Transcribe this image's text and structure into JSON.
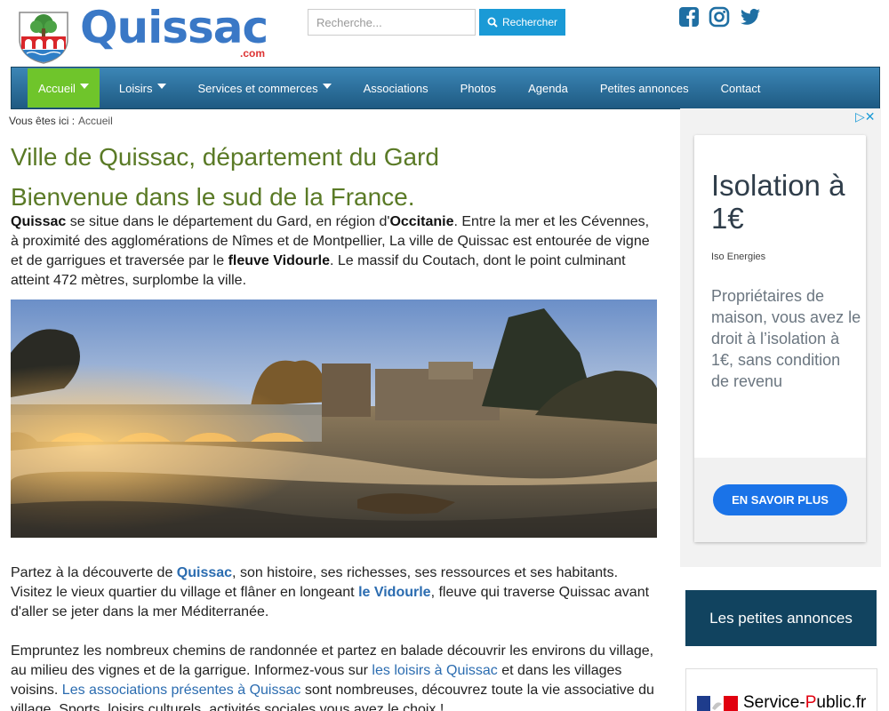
{
  "header": {
    "logo_name": "Quissac",
    "logo_suffix": ".com",
    "search_placeholder": "Recherche...",
    "search_button": "Rechercher",
    "social": [
      "facebook-icon",
      "instagram-icon",
      "twitter-icon"
    ]
  },
  "nav": {
    "items": [
      {
        "label": "Accueil",
        "dropdown": true,
        "active": true
      },
      {
        "label": "Loisirs",
        "dropdown": true
      },
      {
        "label": "Services et commerces",
        "dropdown": true
      },
      {
        "label": "Associations"
      },
      {
        "label": "Photos"
      },
      {
        "label": "Agenda"
      },
      {
        "label": "Petites annonces"
      },
      {
        "label": "Contact"
      }
    ]
  },
  "breadcrumb": {
    "label": "Vous êtes ici :",
    "current": "Accueil"
  },
  "main": {
    "title": "Ville de Quissac, département du Gard",
    "subtitle": "Bienvenue dans le sud de la France.",
    "intro": {
      "b1": "Quissac",
      "t1": " se situe dans le département du Gard, en région d'",
      "b2": "Occitanie",
      "t2": ". Entre la mer et les Cévennes, à proximité des agglomérations de Nîmes et de Montpellier, La ville de Quissac est entourée de vigne et de garrigues et traversée par le ",
      "b3": "fleuve Vidourle",
      "t3": ". Le massif du Coutach, dont le point culminant atteint 472 mètres, surplombe la ville."
    },
    "p2": {
      "t1": "Partez à la découverte de ",
      "l1": "Quissac",
      "t2": ", son histoire, ses richesses, ses ressources et ses habitants. Visitez le vieux quartier du village et flâner en longeant ",
      "l2": "le Vidourle",
      "t3": ", fleuve qui traverse Quissac avant d'aller se jeter dans la mer Méditerranée."
    },
    "p3": {
      "t1": "Empruntez les nombreux chemins de randonnée et partez en balade découvrir les environs du village, au milieu des vignes et de la garrigue. Informez-vous sur ",
      "l1": "les loisirs à Quissac",
      "t2": " et dans les villages voisins. ",
      "l2": "Les associations présentes à Quissac",
      "t3": " sont nombreuses, découvrez toute la vie associative du village. Sports, loisirs culturels, activités sociales vous avez le choix !"
    }
  },
  "sidebar": {
    "ad": {
      "heading": "Isolation à 1€",
      "brand": "Iso Energies",
      "body": "Propriétaires de maison, vous avez le droit à l’isolation à 1€, sans condition de revenu",
      "cta": "EN SAVOIR PLUS",
      "accent": "#1a73e8"
    },
    "annonces": "Les petites annonces",
    "service_public": {
      "a": "Service-",
      "b": "P",
      "c": "ublic.fr"
    }
  },
  "colors": {
    "nav_blue": "#2a6f9c",
    "nav_active": "#6fc52b",
    "title_green": "#5a7a26",
    "link_blue": "#2b6cb0",
    "search_button": "#1a9ad6",
    "annonces_bg": "#11435f"
  }
}
